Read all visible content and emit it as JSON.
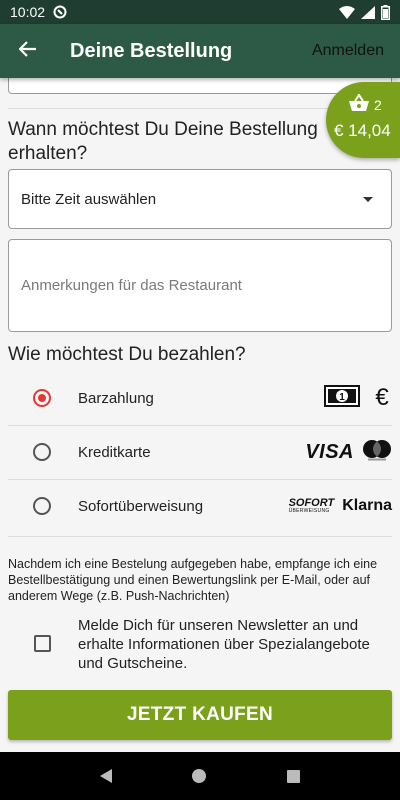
{
  "status_bar": {
    "time": "10:02"
  },
  "app_bar": {
    "back_icon": "arrow-left-icon",
    "title": "Deine Bestellung",
    "login_label": "Anmelden"
  },
  "cart": {
    "count": "2",
    "total": "€ 14,04"
  },
  "delivery": {
    "question": "Wann möchtest Du Deine Bestellung erhalten?",
    "time_select": "Bitte Zeit auswählen",
    "notes_placeholder": "Anmerkungen für das Restaurant"
  },
  "payment": {
    "question": "Wie möchtest Du bezahlen?",
    "options": [
      {
        "label": "Barzahlung",
        "selected": true
      },
      {
        "label": "Kreditkarte",
        "selected": false
      },
      {
        "label": "Sofortüberweisung",
        "selected": false
      }
    ],
    "logos": {
      "visa": "VISA",
      "sofort": "SOFORT",
      "sofort_sub": "ÜBERWEISUNG",
      "klarna": "Klarna",
      "euro": "€"
    }
  },
  "terms_text": "Nachdem ich eine Bestelung aufgegeben habe, empfange ich eine Bestellbestätigung und einen Bewertungslink per E-Mail, oder auf anderem Wege (z.B. Push-Nachrichten)",
  "newsletter": {
    "label": "Melde Dich für unseren Newsletter an und erhalte Informationen über Spezialangebote und Gutscheine.",
    "checked": false
  },
  "buy_button": "JETZT KAUFEN",
  "colors": {
    "header": "#2d5a47",
    "accent": "#7ba11c",
    "radio_selected": "#e53935"
  }
}
